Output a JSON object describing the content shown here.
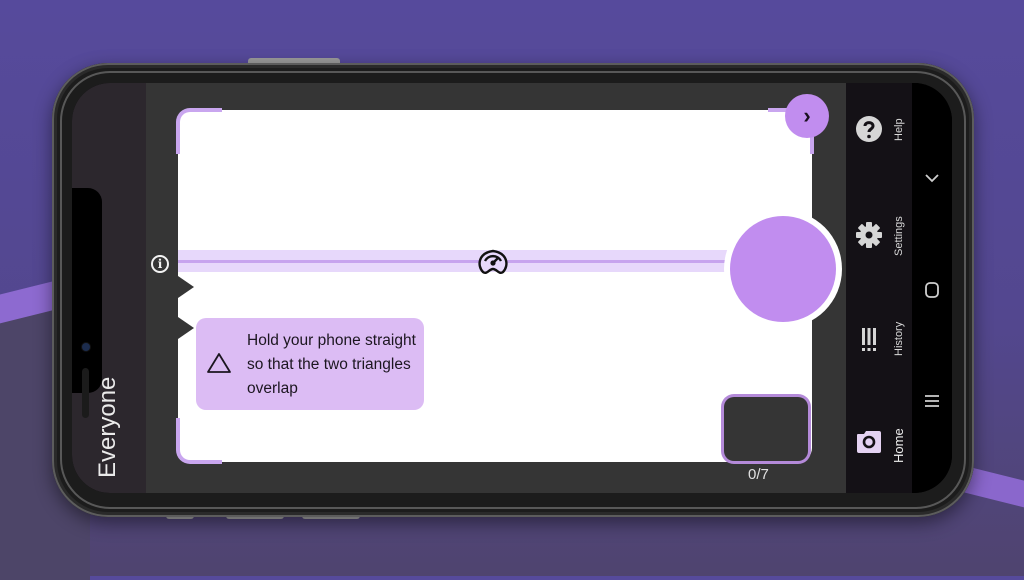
{
  "app": {
    "audience_label": "Everyone"
  },
  "viewfinder": {
    "next_button_label": "›",
    "info_icon": "info-icon",
    "level_indicator_icon": "gauge-icon",
    "hint": {
      "icon": "triangle-warning-icon",
      "text": "Hold your phone straight so that the two triangles overlap"
    },
    "capture_counter": "0/7"
  },
  "rail": {
    "items": [
      {
        "label": "Help",
        "icon": "help-icon"
      },
      {
        "label": "Settings",
        "icon": "gear-icon"
      },
      {
        "label": "History",
        "icon": "history-icon"
      },
      {
        "label": "Home",
        "icon": "camera-icon",
        "active": true
      }
    ]
  },
  "system_nav": {
    "buttons": [
      {
        "name": "back",
        "glyph": "‹"
      },
      {
        "name": "home",
        "glyph": "○"
      },
      {
        "name": "recents",
        "glyph": "|||"
      }
    ]
  },
  "colors": {
    "accent": "#c18def",
    "hint_bg": "#dcbcf4",
    "level_band": "#e7d8fb",
    "rail_bg": "#141116",
    "camera_area": "#353535",
    "background": "#564a9c"
  }
}
